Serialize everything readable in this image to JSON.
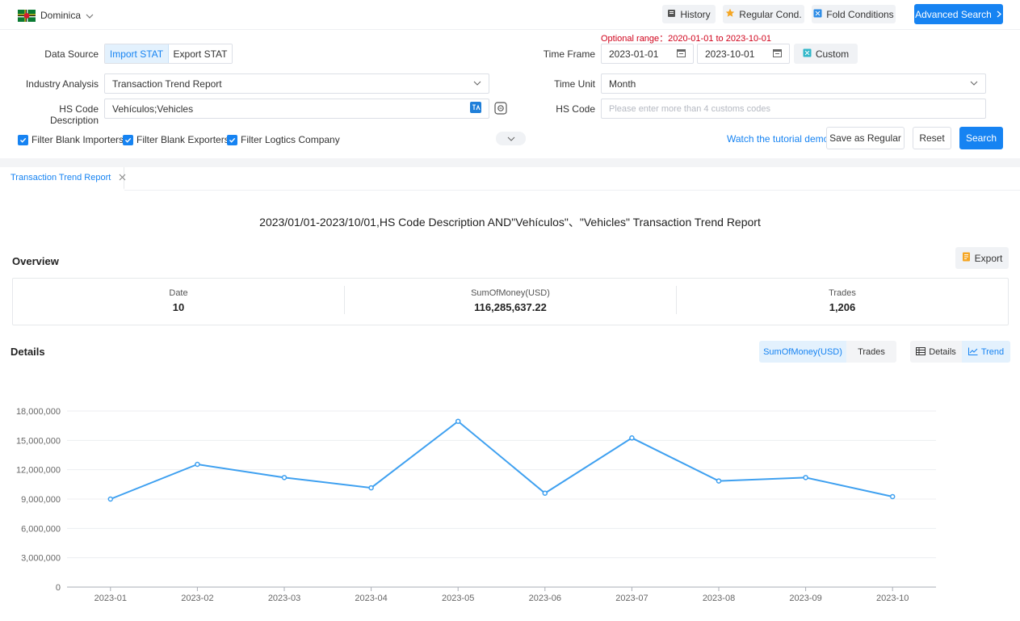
{
  "header": {
    "country": "Dominica",
    "history_label": "History",
    "regular_label": "Regular Cond.",
    "fold_label": "Fold Conditions",
    "advanced_label": "Advanced Search"
  },
  "filters": {
    "optional_range_label": "Optional range：",
    "optional_range_value": "2020-01-01 to 2023-10-01",
    "data_source_label": "Data Source",
    "import_label": "Import STAT",
    "export_label": "Export STAT",
    "time_frame_label": "Time Frame",
    "start_date": "2023-01-01",
    "end_date": "2023-10-01",
    "custom_label": "Custom",
    "industry_label": "Industry Analysis",
    "industry_value": "Transaction Trend Report",
    "time_unit_label": "Time Unit",
    "time_unit_value": "Month",
    "hs_desc_label": "HS Code Description",
    "hs_desc_value": "Vehículos;Vehicles",
    "hs_code_label": "HS Code",
    "hs_code_placeholder": "Please enter more than 4 customs codes",
    "filter_importers": "Filter Blank Importers",
    "filter_exporters": "Filter Blank Exporters",
    "filter_logistics": "Filter Logtics Company",
    "tutorial_link": "Watch the tutorial demo",
    "save_regular": "Save as Regular",
    "reset": "Reset",
    "search": "Search"
  },
  "report": {
    "tab_label": "Transaction Trend Report",
    "title": "2023/01/01-2023/10/01,HS Code Description AND\"Vehículos\"、\"Vehicles\" Transaction Trend Report",
    "overview_label": "Overview",
    "export_label": "Export",
    "stats": [
      {
        "label": "Date",
        "value": "10"
      },
      {
        "label": "SumOfMoney(USD)",
        "value": "116,285,637.22"
      },
      {
        "label": "Trades",
        "value": "1,206"
      }
    ],
    "details_label": "Details",
    "metric_toggle": [
      "SumOfMoney(USD)",
      "Trades"
    ],
    "view_toggle": [
      "Details",
      "Trend"
    ]
  },
  "colors": {
    "accent": "#1683f2",
    "line": "#3ea0f0",
    "warning": "#d0021b"
  },
  "chart_data": {
    "type": "line",
    "categories": [
      "2023-01",
      "2023-02",
      "2023-03",
      "2023-04",
      "2023-05",
      "2023-06",
      "2023-07",
      "2023-08",
      "2023-09",
      "2023-10"
    ],
    "series": [
      {
        "values": [
          9000000,
          12550000,
          11200000,
          10150000,
          16950000,
          9600000,
          15250000,
          10850000,
          11200000,
          9250000
        ]
      }
    ],
    "yticks": [
      "0",
      "3,000,000",
      "6,000,000",
      "9,000,000",
      "12,000,000",
      "15,000,000",
      "18,000,000"
    ],
    "ylim": [
      0,
      18000000
    ],
    "grid": true
  }
}
